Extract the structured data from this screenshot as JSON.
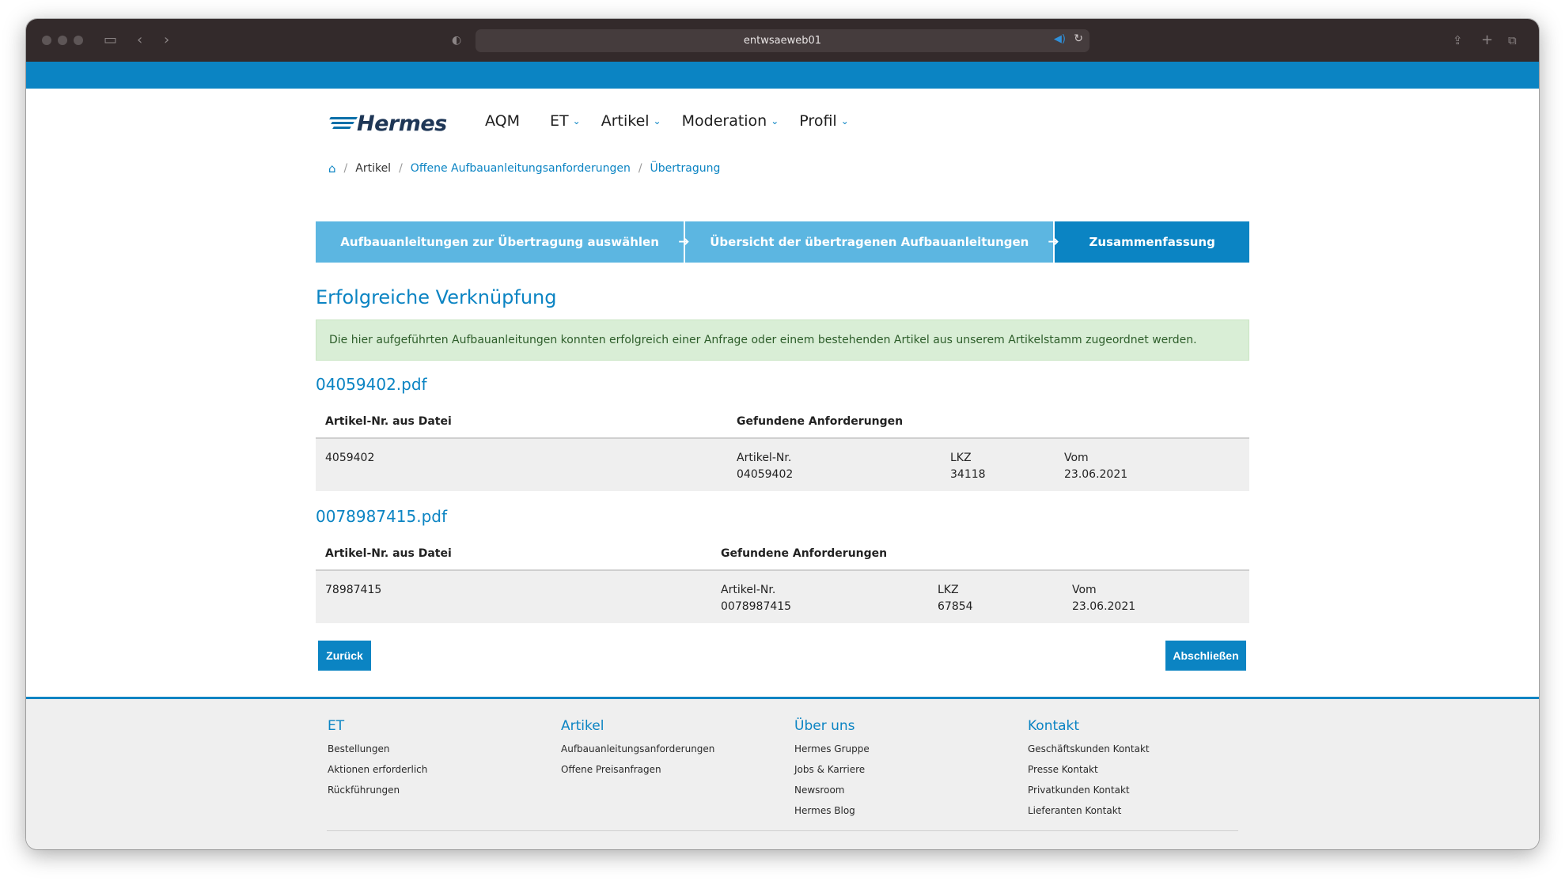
{
  "browser": {
    "url": "entwsaeweb01"
  },
  "brand": {
    "name": "Hermes",
    "accent": "#0b84c3",
    "dark": "#1e3656"
  },
  "nav": [
    {
      "label": "AQM",
      "dropdown": false
    },
    {
      "label": "ET",
      "dropdown": true
    },
    {
      "label": "Artikel",
      "dropdown": true
    },
    {
      "label": "Moderation",
      "dropdown": true
    },
    {
      "label": "Profil",
      "dropdown": true
    }
  ],
  "breadcrumb": {
    "item1": "Artikel",
    "item2": "Offene Aufbauanleitungsanforderungen",
    "item3": "Übertragung"
  },
  "steps": [
    {
      "label": "Aufbauanleitungen zur Übertragung auswählen",
      "active": false
    },
    {
      "label": "Übersicht der übertragenen Aufbauanleitungen",
      "active": false
    },
    {
      "label": "Zusammenfassung",
      "active": true
    }
  ],
  "main": {
    "heading": "Erfolgreiche Verknüpfung",
    "alert": "Die hier aufgeführten Aufbauanleitungen konnten erfolgreich einer Anfrage oder einem bestehenden Artikel aus unserem Artikelstamm zugeordnet werden."
  },
  "files": [
    {
      "title": "04059402.pdf",
      "col_file": "Artikel-Nr. aus Datei",
      "col_found": "Gefundene Anforderungen",
      "file_article": "4059402",
      "article_label": "Artikel-Nr.",
      "article_value": "04059402",
      "lkz_label": "LKZ",
      "lkz_value": "34118",
      "vom_label": "Vom",
      "vom_value": "23.06.2021"
    },
    {
      "title": "0078987415.pdf",
      "col_file": "Artikel-Nr. aus Datei",
      "col_found": "Gefundene Anforderungen",
      "file_article": "78987415",
      "article_label": "Artikel-Nr.",
      "article_value": "0078987415",
      "lkz_label": "LKZ",
      "lkz_value": "67854",
      "vom_label": "Vom",
      "vom_value": "23.06.2021"
    }
  ],
  "buttons": {
    "back": "Zurück",
    "finish": "Abschließen"
  },
  "footer": {
    "et": {
      "title": "ET",
      "links": [
        "Bestellungen",
        "Aktionen erforderlich",
        "Rückführungen"
      ]
    },
    "artikel": {
      "title": "Artikel",
      "links": [
        "Aufbauanleitungsanforderungen",
        "Offene Preisanfragen"
      ]
    },
    "about": {
      "title": "Über uns",
      "links": [
        "Hermes Gruppe",
        "Jobs & Karriere",
        "Newsroom",
        "Hermes Blog"
      ]
    },
    "kontakt": {
      "title": "Kontakt",
      "links": [
        "Geschäftskunden Kontakt",
        "Presse Kontakt",
        "Privatkunden Kontakt",
        "Lieferanten Kontakt"
      ]
    }
  }
}
